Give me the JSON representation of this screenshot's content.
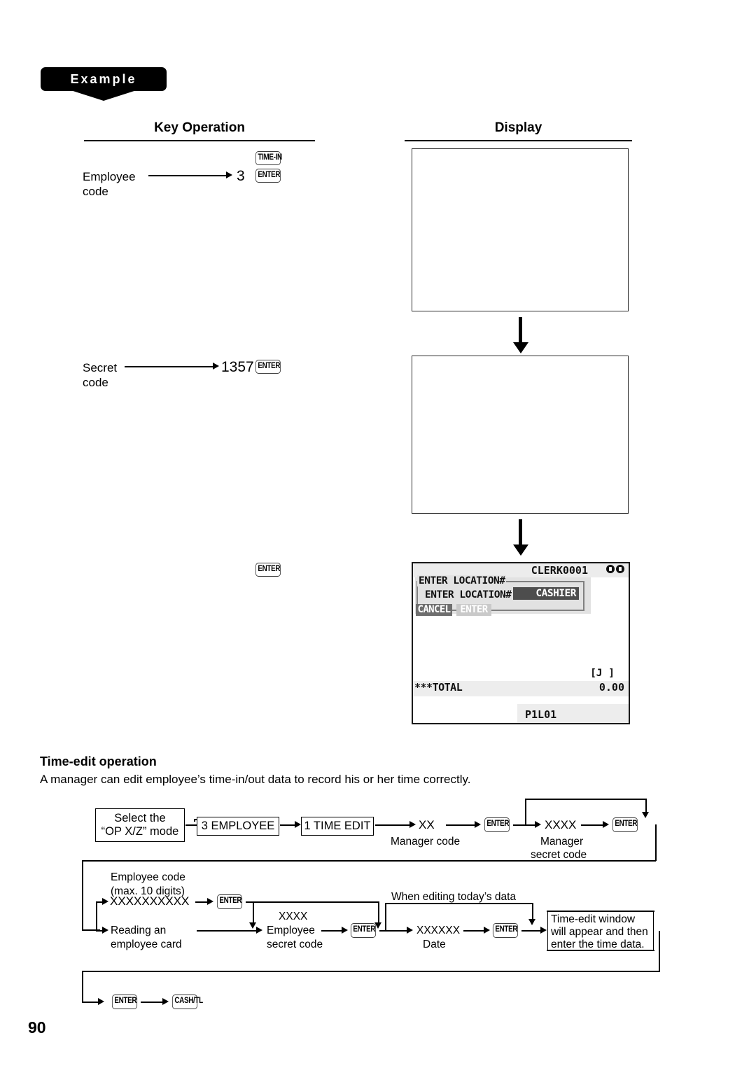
{
  "banner": {
    "label": "Example"
  },
  "columns": {
    "key_operation": "Key Operation",
    "display": "Display"
  },
  "key_operation_steps": [
    {
      "label_line1": "Employee",
      "label_line2": "code",
      "value": "3",
      "keys": [
        "TIME-IN",
        "ENTER"
      ]
    },
    {
      "label_line1": "Secret",
      "label_line2": "code",
      "value": "1357",
      "keys": [
        "ENTER"
      ]
    },
    {
      "label_line1": "",
      "label_line2": "",
      "value": "",
      "keys": [
        "ENTER"
      ]
    }
  ],
  "display_screens": [
    {
      "type": "blank"
    },
    {
      "type": "blank"
    },
    {
      "type": "lcd",
      "status": {
        "clerk": "CLERK0001",
        "indicators": [
          "dot",
          "dot"
        ]
      },
      "dialog": {
        "title": "ENTER LOCATION#",
        "prompt": "ENTER LOCATION#",
        "value": "CASHIER",
        "buttons": [
          {
            "label": "CANCEL",
            "state": "selected"
          },
          {
            "label": "ENTER",
            "state": "normal"
          }
        ]
      },
      "journal_flag": "[J ]",
      "total_label": "***TOTAL",
      "total_value": "0.00",
      "page_indicator": "P1L01"
    }
  ],
  "section": {
    "heading": "Time-edit operation",
    "body": "A manager can edit employee’s time-in/out data to record his or her time correctly."
  },
  "flow": {
    "row1": {
      "start_box_line1": "Select the",
      "start_box_line2": "“OP X/Z” mode",
      "menu_box_1": "3 EMPLOYEE",
      "menu_box_2": "1 TIME EDIT",
      "manager_code_value": "XX",
      "manager_code_label": "Manager code",
      "key_1": "ENTER",
      "manager_secret_value": "XXXX",
      "manager_secret_label_line1": "Manager",
      "manager_secret_label_line2": "secret code",
      "key_2": "ENTER"
    },
    "row2": {
      "employee_code_label_line1": "Employee code",
      "employee_code_label_line2": "(max. 10 digits)",
      "employee_code_value": "XXXXXXXXXX",
      "key_1": "ENTER",
      "alt_path_line1": "Reading an",
      "alt_path_line2": "employee card",
      "employee_secret_value": "XXXX",
      "employee_secret_label_line1": "Employee",
      "employee_secret_label_line2": "secret code",
      "key_2": "ENTER",
      "today_note": "When editing today’s data",
      "date_value": "XXXXXX",
      "date_label": "Date",
      "key_3": "ENTER",
      "result_line1": "Time-edit window",
      "result_line2": "will appear and then",
      "result_line3": "enter the time data."
    },
    "row3": {
      "key_1": "ENTER",
      "key_2": "CASH/TL"
    }
  },
  "page_number": "90"
}
